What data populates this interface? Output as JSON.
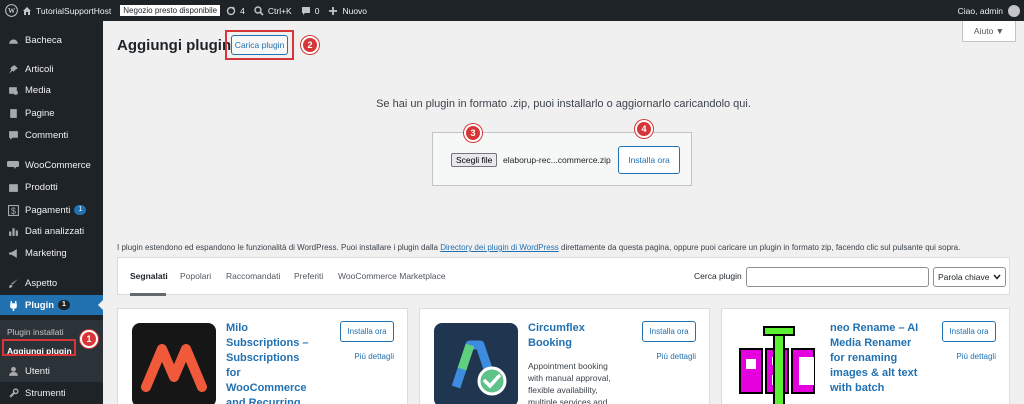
{
  "adminbar": {
    "site_name": "TutorialSupportHost",
    "store_badge": "Negozio presto disponibile",
    "updates_count": "4",
    "search_shortcut": "Ctrl+K",
    "comments_count": "0",
    "new_label": "Nuovo",
    "greeting": "Ciao, admin"
  },
  "sidebar": {
    "items": [
      {
        "label": "Bacheca",
        "icon": "dashboard-icon"
      },
      {
        "label": "Articoli",
        "icon": "pin-icon"
      },
      {
        "label": "Media",
        "icon": "media-icon"
      },
      {
        "label": "Pagine",
        "icon": "page-icon"
      },
      {
        "label": "Commenti",
        "icon": "comment-icon"
      },
      {
        "label": "WooCommerce",
        "icon": "woo-icon"
      },
      {
        "label": "Prodotti",
        "icon": "archive-icon"
      },
      {
        "label": "Pagamenti",
        "icon": "dollar-icon",
        "count": "1"
      },
      {
        "label": "Dati analizzati",
        "icon": "chart-icon"
      },
      {
        "label": "Marketing",
        "icon": "megaphone-icon"
      },
      {
        "label": "Aspetto",
        "icon": "brush-icon"
      },
      {
        "label": "Plugin",
        "icon": "plugin-icon",
        "count": "1"
      },
      {
        "label": "Utenti",
        "icon": "user-icon"
      },
      {
        "label": "Strumenti",
        "icon": "tools-icon"
      }
    ],
    "submenu": {
      "installed": "Plugin installati",
      "add_new": "Aggiungi plugin"
    }
  },
  "main": {
    "title": "Aggiungi plugin",
    "upload_button": "Carica plugin",
    "help_button": "Aiuto ▼",
    "upload_message": "Se hai un plugin in formato .zip, puoi installarlo o aggiornarlo caricandolo qui.",
    "choose_file": "Scegli file",
    "file_name": "elaborup-rec...commerce.zip",
    "install_now": "Installa ora",
    "info_before": "I plugin estendono ed espandono le funzionalità di WordPress. Puoi installare i plugin dalla ",
    "info_link": "Directory dei plugin di WordPress",
    "info_after": " direttamente da questa pagina, oppure puoi caricare un plugin in formato zip, facendo clic sul pulsante qui sopra."
  },
  "tabs": [
    "Segnalati",
    "Popolari",
    "Raccomandati",
    "Preferiti",
    "WooCommerce Marketplace"
  ],
  "search": {
    "label": "Cerca plugin",
    "value": "",
    "type_select": "Parola chiave"
  },
  "steps": [
    "1",
    "2",
    "3",
    "4"
  ],
  "cards": [
    {
      "name": "Milo Subscriptions – Subscriptions for WooCommerce and Recurring",
      "description": "",
      "install": "Installa ora",
      "details": "Più dettagli"
    },
    {
      "name": "Circumflex Booking",
      "description": "Appointment booking with manual approval, flexible availability, multiple services and",
      "install": "Installa ora",
      "details": "Più dettagli"
    },
    {
      "name": "neo Rename – AI Media Renamer for renaming images & alt text with batch",
      "description": "",
      "install": "Installa ora",
      "details": "Più dettagli"
    }
  ],
  "colors": {
    "wp_blue": "#2271b1",
    "dark": "#1d2327",
    "annotation_red": "#d63638",
    "milo_orange": "#f05a3b",
    "abc_magenta": "#e500e0",
    "abc_green": "#5bf032"
  }
}
